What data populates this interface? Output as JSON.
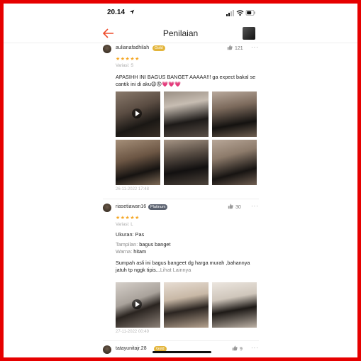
{
  "status": {
    "time": "20.14"
  },
  "header": {
    "title": "Penilaian"
  },
  "reviews": [
    {
      "username": "aulianafadhilah",
      "badge": "Gold",
      "likes": "121",
      "stars": "★★★★★",
      "variasi": "Variasi: S",
      "text": "APASIHH INI BAGUS BANGET AAAAA!!! ga expect bakal se cantik ini di aku😩😡💗💗💗",
      "date": "26-11-2022 17:48"
    },
    {
      "username": "riasetiawan16",
      "badge": "Platinum",
      "likes": "30",
      "stars": "★★★★★",
      "variasi": "Variasi: L",
      "ukuran_label": "Ukuran:",
      "ukuran_value": "Pas",
      "tampilan_label": "Tampilan:",
      "tampilan_value": "bagus banget",
      "warna_label": "Warna:",
      "warna_value": "hitam",
      "text": "Sumpah asli ini bagus bangeet dg harga murah ,bahannya jatuh tp nggk tipis...",
      "more_link": "Lihat Lainnya",
      "date": "27-11-2022 00:49"
    },
    {
      "username": "tatayunitajr.28",
      "badge": "Gold",
      "likes": "9",
      "stars": "★★★★★"
    }
  ],
  "more_symbol": "···",
  "colors": {
    "accent": "#ee4d2d",
    "star": "#f5a623",
    "gold": "#e3b53b",
    "platinum": "#5b6270",
    "frame": "#e60000"
  },
  "icons": [
    "back-arrow-icon",
    "thumbs-up-icon",
    "play-icon",
    "location-arrow-icon",
    "signal-icon",
    "wifi-icon",
    "battery-icon"
  ]
}
